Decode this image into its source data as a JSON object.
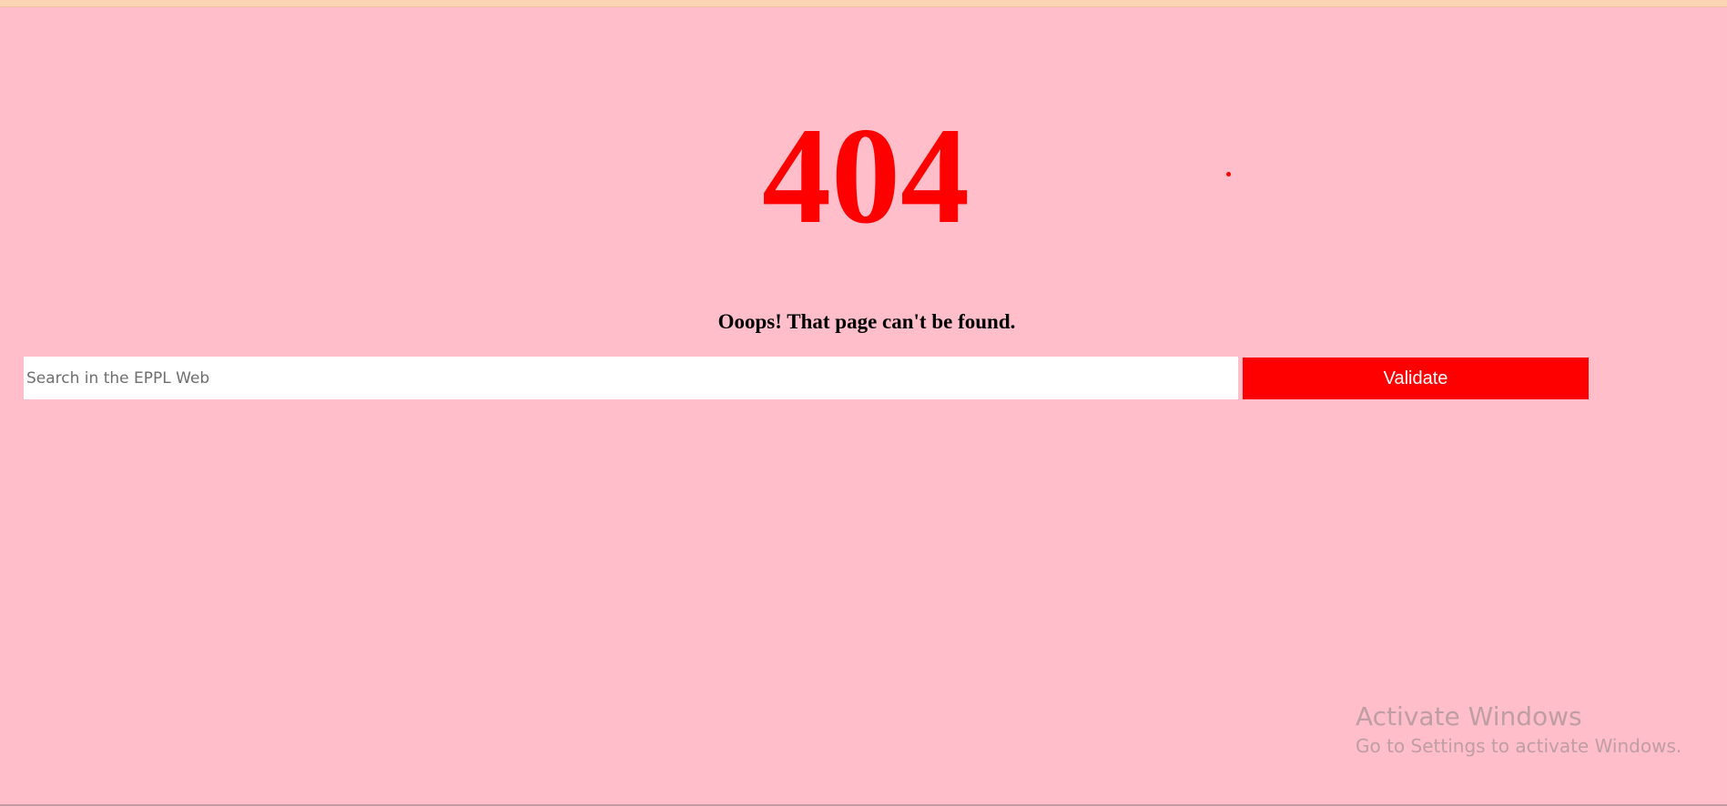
{
  "page": {
    "error_code": "404",
    "message": "Ooops! That page can't be found."
  },
  "search": {
    "placeholder": "Search in the EPPL Web",
    "value": "",
    "button_label": "Validate"
  },
  "watermark": {
    "title": "Activate Windows",
    "subtitle": "Go to Settings to activate Windows."
  },
  "colors": {
    "background": "#ffbec9",
    "accent": "#ff0000",
    "button_text": "#ffffff"
  }
}
